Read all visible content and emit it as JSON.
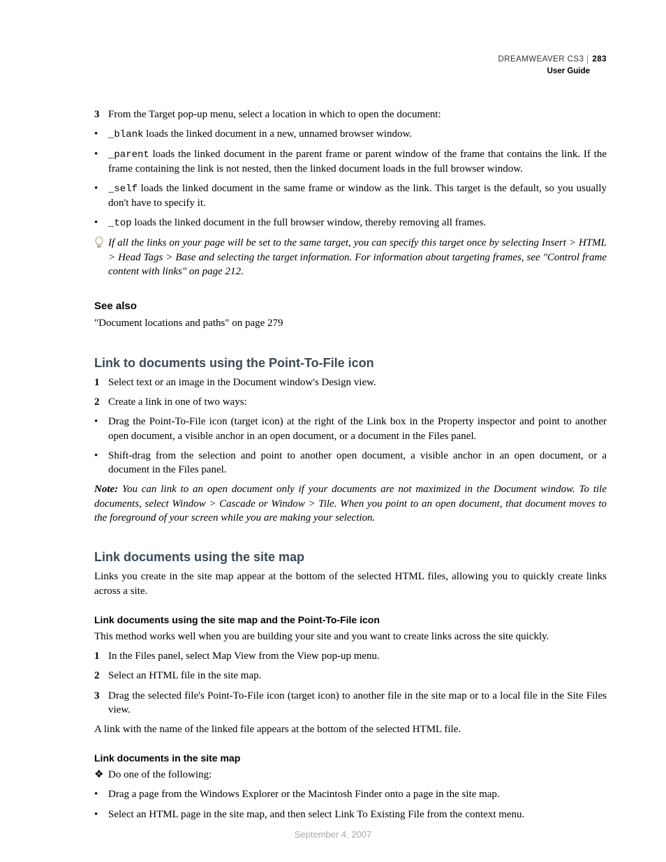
{
  "header": {
    "product": "DREAMWEAVER CS3",
    "page_number": "283",
    "subtitle": "User Guide"
  },
  "s1": {
    "step3": "From the Target pop-up menu, select a location in which to open the document:",
    "blank_code": "_blank",
    "blank_text": " loads the linked document in a new, unnamed browser window.",
    "parent_code": "_parent",
    "parent_text": " loads the linked document in the parent frame or parent window of the frame that contains the link. If the frame containing the link is not nested, then the linked document loads in the full browser window.",
    "self_code": "_self",
    "self_text": " loads the linked document in the same frame or window as the link. This target is the default, so you usually don't have to specify it.",
    "top_code": "_top",
    "top_text": " loads the linked document in the full browser window, thereby removing all frames.",
    "tip": "If all the links on your page will be set to the same target, you can specify this target once by selecting Insert > HTML > Head Tags > Base and selecting the target information. For information about targeting frames, see \"Control frame content with links\" on page 212."
  },
  "seealso": {
    "heading": "See also",
    "link": "\"Document locations and paths\" on page 279"
  },
  "s2": {
    "heading": "Link to documents using the Point-To-File icon",
    "step1": "Select text or an image in the Document window's Design view.",
    "step2": "Create a link in one of two ways:",
    "b1": "Drag the Point-To-File icon (target icon) at the right of the Link box in the Property inspector and point to another open document, a visible anchor in an open document, or a document in the Files panel.",
    "b2": "Shift-drag from the selection and point to another open document, a visible anchor in an open document, or a document in the Files panel.",
    "note_label": "Note:",
    "note": " You can link to an open document only if your documents are not maximized in the Document window. To tile documents, select Window > Cascade or Window > Tile. When you point to an open document, that document moves to the foreground of your screen while you are making your selection."
  },
  "s3": {
    "heading": "Link documents using the site map",
    "intro": "Links you create in the site map appear at the bottom of the selected HTML files, allowing you to quickly create links across a site.",
    "sub1_heading": "Link documents using the site map and the Point-To-File icon",
    "sub1_intro": "This method works well when you are building your site and you want to create links across the site quickly.",
    "sub1_step1": "In the Files panel, select Map View from the View pop-up menu.",
    "sub1_step2": "Select an HTML file in the site map.",
    "sub1_step3": "Drag the selected file's Point-To-File icon (target icon) to another file in the site map or to a local file in the Site Files view.",
    "sub1_result": "A link with the name of the linked file appears at the bottom of the selected HTML file.",
    "sub2_heading": "Link documents in the site map",
    "sub2_intro": "Do one of the following:",
    "sub2_b1": "Drag a page from the Windows Explorer or the Macintosh Finder onto a page in the site map.",
    "sub2_b2": "Select an HTML page in the site map, and then select Link To Existing File from the context menu."
  },
  "footer_date": "September 4, 2007"
}
